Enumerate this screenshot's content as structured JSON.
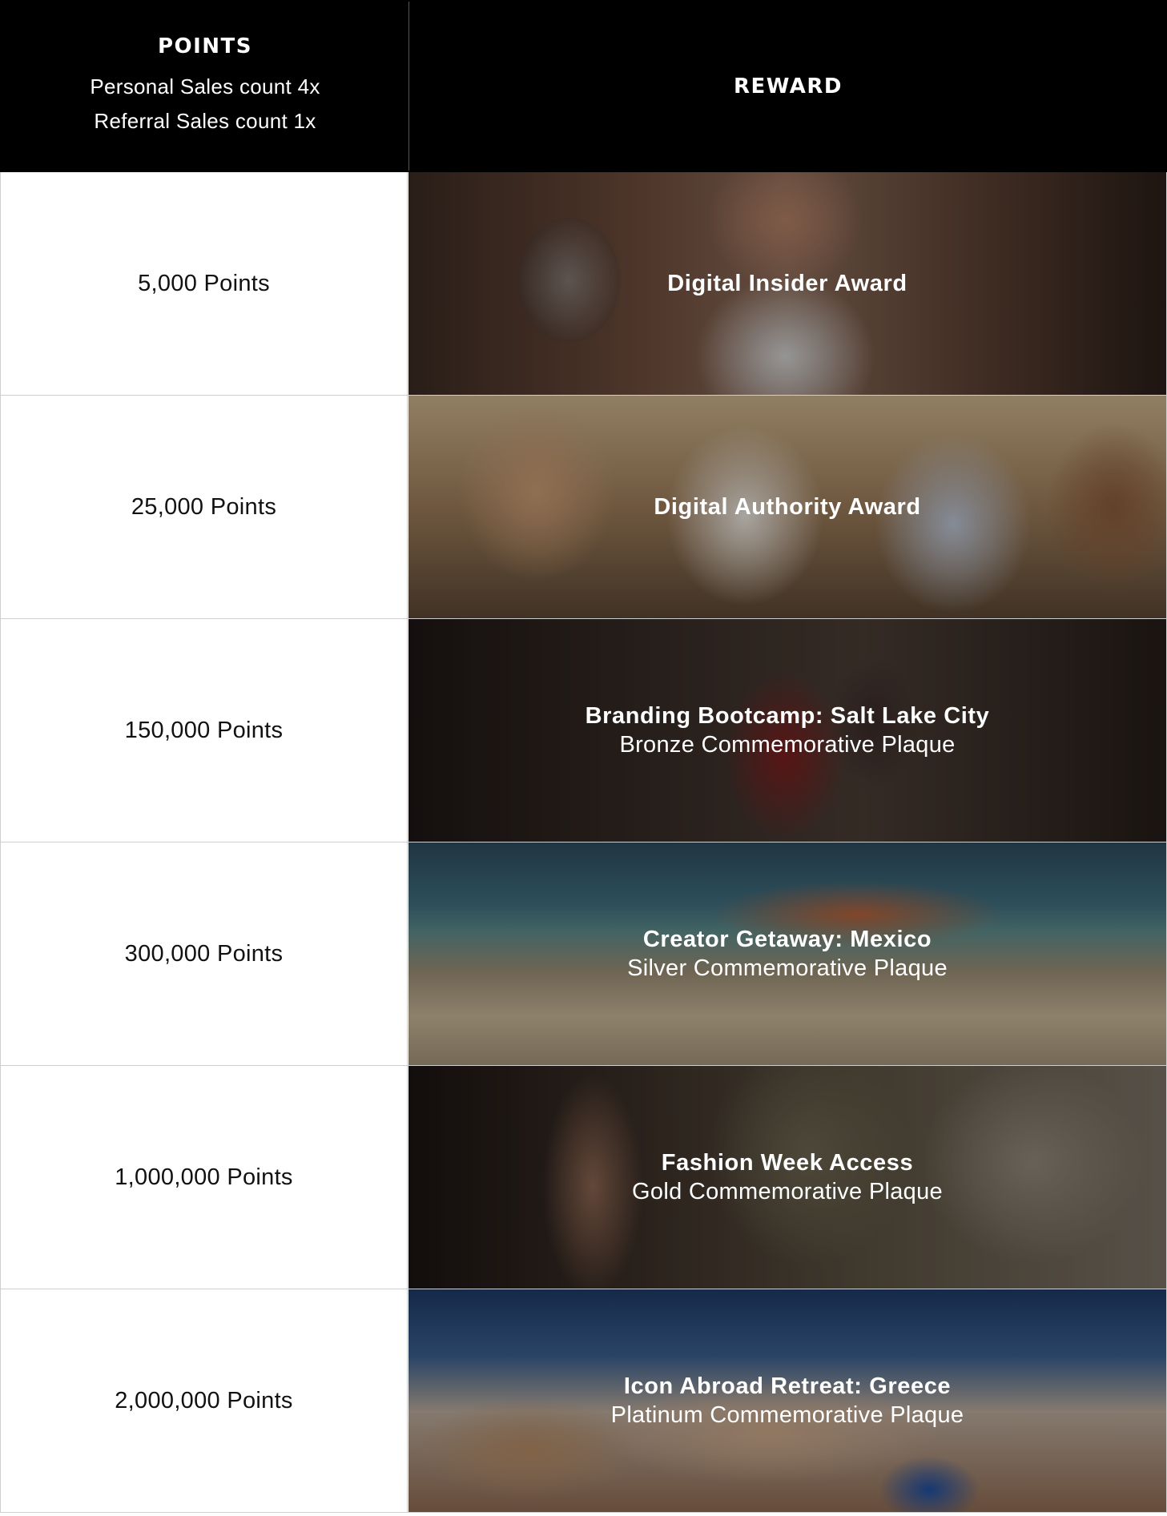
{
  "header": {
    "points_title": "POINTS",
    "points_lines": [
      "Personal Sales count 4x",
      "Referral Sales count 1x"
    ],
    "reward_title": "REWARD"
  },
  "rows": [
    {
      "points": "5,000 Points",
      "reward_title": "Digital Insider Award",
      "reward_subtitle": ""
    },
    {
      "points": "25,000 Points",
      "reward_title": "Digital Authority Award",
      "reward_subtitle": ""
    },
    {
      "points": "150,000 Points",
      "reward_title": "Branding Bootcamp: Salt Lake City",
      "reward_subtitle": "Bronze Commemorative Plaque"
    },
    {
      "points": "300,000 Points",
      "reward_title": "Creator Getaway: Mexico",
      "reward_subtitle": "Silver Commemorative Plaque"
    },
    {
      "points": "1,000,000 Points",
      "reward_title": "Fashion Week Access",
      "reward_subtitle": "Gold Commemorative Plaque"
    },
    {
      "points": "2,000,000 Points",
      "reward_title": "Icon Abroad Retreat: Greece",
      "reward_subtitle": "Platinum Commemorative Plaque"
    }
  ]
}
